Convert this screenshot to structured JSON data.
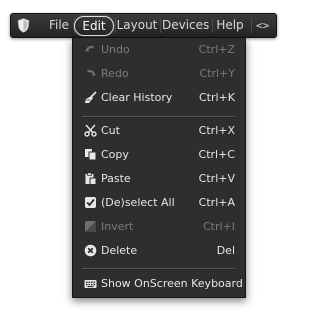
{
  "menubar": {
    "logo_icon": "shield-icon",
    "items": [
      {
        "label": "File"
      },
      {
        "label": "Edit",
        "active": true
      },
      {
        "label": "Layout"
      },
      {
        "label": "Devices"
      },
      {
        "label": "Help"
      }
    ],
    "code_label": "<>"
  },
  "edit_menu": {
    "items": [
      {
        "label": "Undo",
        "shortcut": "Ctrl+Z",
        "icon": "undo-icon",
        "enabled": false
      },
      {
        "label": "Redo",
        "shortcut": "Ctrl+Y",
        "icon": "redo-icon",
        "enabled": false
      },
      {
        "label": "Clear History",
        "shortcut": "Ctrl+K",
        "icon": "broom-icon",
        "enabled": true
      },
      {
        "label": "Cut",
        "shortcut": "Ctrl+X",
        "icon": "scissors-icon",
        "enabled": true
      },
      {
        "label": "Copy",
        "shortcut": "Ctrl+C",
        "icon": "copy-icon",
        "enabled": true
      },
      {
        "label": "Paste",
        "shortcut": "Ctrl+V",
        "icon": "paste-icon",
        "enabled": true
      },
      {
        "label": "(De)select All",
        "shortcut": "Ctrl+A",
        "icon": "checkbox-icon",
        "enabled": true
      },
      {
        "label": "Invert",
        "shortcut": "Ctrl+I",
        "icon": "invert-icon",
        "enabled": false
      },
      {
        "label": "Delete",
        "shortcut": "Del",
        "icon": "delete-icon",
        "enabled": true
      },
      {
        "label": "Show OnScreen Keyboard",
        "shortcut": "",
        "icon": "keyboard-icon",
        "enabled": true
      }
    ]
  },
  "colors": {
    "menu_bg": "#2e2e2e",
    "menubar_bg": "#2c2c2c",
    "text": "#e6e6e6",
    "disabled_text": "#7a7a7a"
  }
}
